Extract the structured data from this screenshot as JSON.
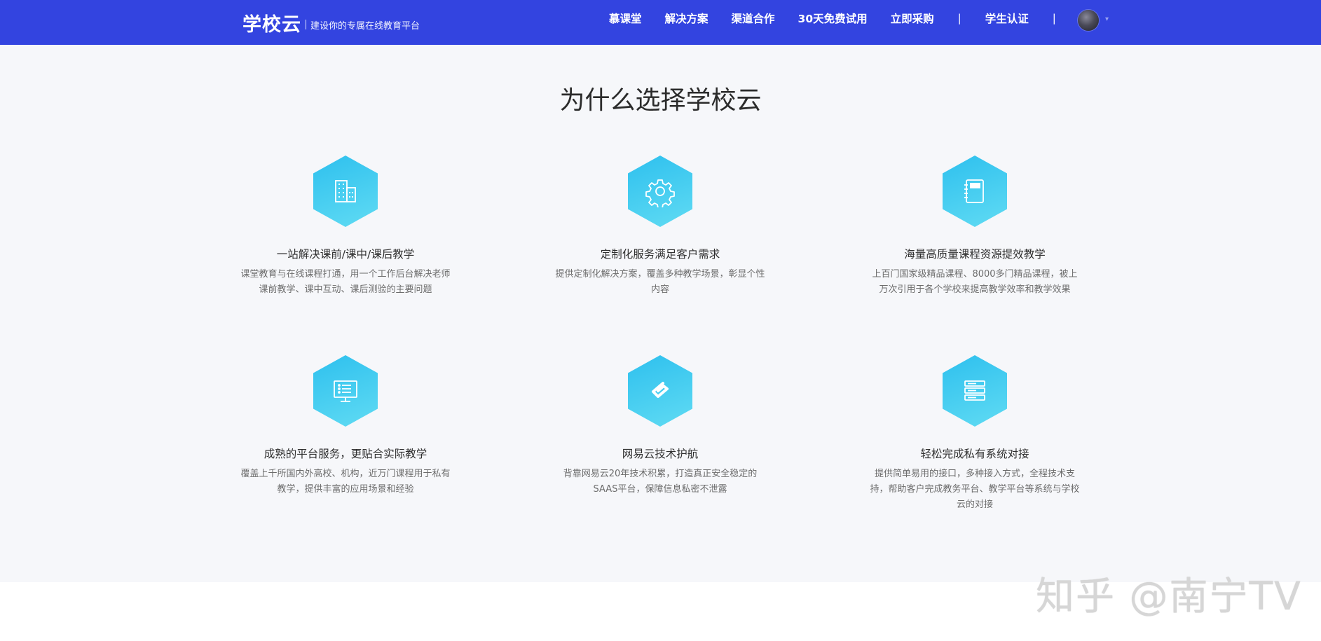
{
  "header": {
    "logo": "学校云",
    "slogan": "建设你的专属在线教育平台",
    "nav": {
      "mooc": "慕课堂",
      "solutions": "解决方案",
      "channel": "渠道合作",
      "trial": "30天免费试用",
      "purchase": "立即采购",
      "student_auth": "学生认证"
    },
    "divider": "|",
    "caret": "▾"
  },
  "section": {
    "title": "为什么选择学校云",
    "features": [
      {
        "icon": "building-icon",
        "title": "一站解决课前/课中/课后教学",
        "desc": "课堂教育与在线课程打通，用一个工作后台解决老师课前教学、课中互动、课后测验的主要问题"
      },
      {
        "icon": "gear-icon",
        "title": "定制化服务满足客户需求",
        "desc": "提供定制化解决方案，覆盖多种教学场景，彰显个性内容"
      },
      {
        "icon": "notebook-icon",
        "title": "海量高质量课程资源提效教学",
        "desc": "上百门国家级精品课程、8000多门精品课程，被上万次引用于各个学校来提高教学效率和教学效果"
      },
      {
        "icon": "monitor-icon",
        "title": "成熟的平台服务，更贴合实际教学",
        "desc": "覆盖上千所国内外高校、机构，近万门课程用于私有教学，提供丰富的应用场景和经验"
      },
      {
        "icon": "netease-cloud-icon",
        "title": "网易云技术护航",
        "desc": "背靠网易云20年技术积累，打造真正安全稳定的SAAS平台，保障信息私密不泄露"
      },
      {
        "icon": "server-icon",
        "title": "轻松完成私有系统对接",
        "desc": "提供简单易用的接口，多种接入方式，全程技术支持，帮助客户完成教务平台、教学平台等系统与学校云的对接"
      }
    ]
  },
  "watermark": "知乎 @南宁TV",
  "colors": {
    "header_bg": "#3344e0",
    "section_bg": "#f6f7fa",
    "hex_start": "#2ec0ee",
    "hex_end": "#60dbf3"
  }
}
